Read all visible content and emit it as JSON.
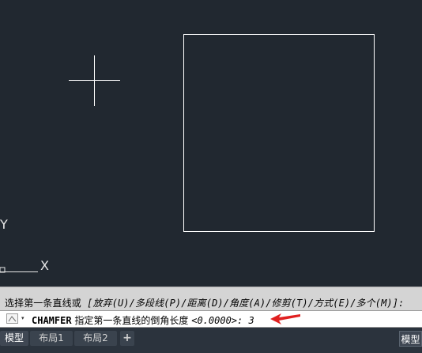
{
  "command_history": {
    "prompt": "选择第一条直线或",
    "options": " [放弃(U)/多段线(P)/距离(D)/角度(A)/修剪(T)/方式(E)/多个(M)]:"
  },
  "command_line": {
    "command": "CHAMFER",
    "prompt": " 指定第一条直线的倒角长度 ",
    "default": "<0.0000>:",
    "input": " 3"
  },
  "ucs": {
    "x_label": "X",
    "y_label": "Y"
  },
  "tabs": [
    {
      "label": "模型",
      "active": true
    },
    {
      "label": "布局1",
      "active": false
    },
    {
      "label": "布局2",
      "active": false
    },
    {
      "label": "+",
      "active": false
    }
  ],
  "status_bar": {
    "space_label": "模型"
  },
  "colors": {
    "canvas_bg": "#212830",
    "entity": "#ffffff",
    "arrow": "#e02020"
  }
}
